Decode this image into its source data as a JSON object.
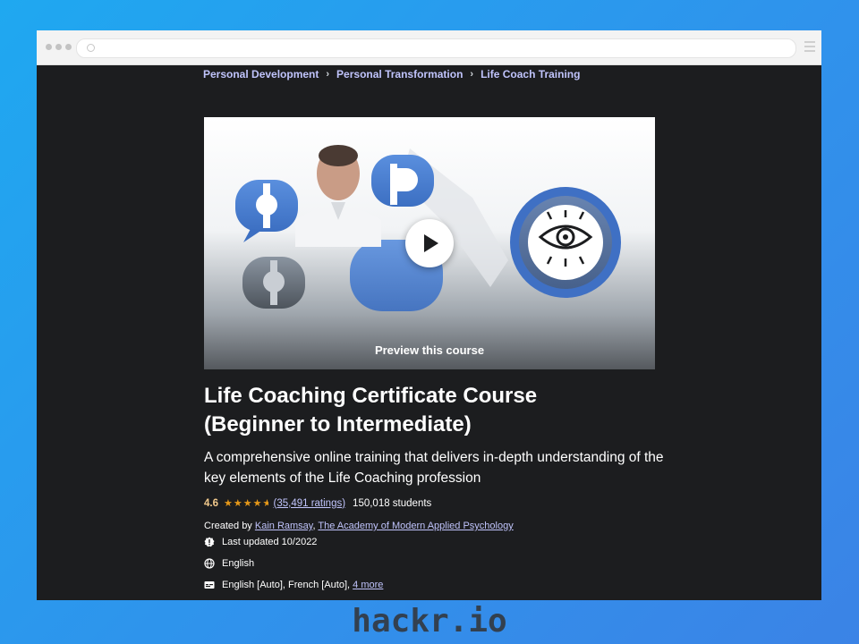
{
  "breadcrumb": [
    "Personal Development",
    "Personal Transformation",
    "Life Coach Training"
  ],
  "video": {
    "preview_label": "Preview this course"
  },
  "course": {
    "title_line1": "Life Coaching Certificate Course",
    "title_line2": "(Beginner to Intermediate)",
    "subtitle": "A comprehensive online training that delivers in-depth understanding of the key elements of the Life Coaching profession",
    "rating": "4.6",
    "rating_value": 4.6,
    "ratings_count": "(35,491 ratings)",
    "students": "150,018 students",
    "created_by_label": "Created by",
    "instructors": [
      "Kain Ramsay",
      "The Academy of Modern Applied Psychology"
    ],
    "last_updated": "Last updated 10/2022",
    "language": "English",
    "captions": "English [Auto], French [Auto],",
    "captions_more": "4 more"
  },
  "brand": "hackr.io",
  "colors": {
    "page_bg": "#1c1d1f",
    "link": "#c0c4fc",
    "rating": "#f3ca8c",
    "star": "#e59819",
    "brand_text": "#33404f"
  },
  "icons": [
    "play-icon",
    "alert-icon",
    "globe-icon",
    "captions-icon",
    "menu-icon"
  ]
}
